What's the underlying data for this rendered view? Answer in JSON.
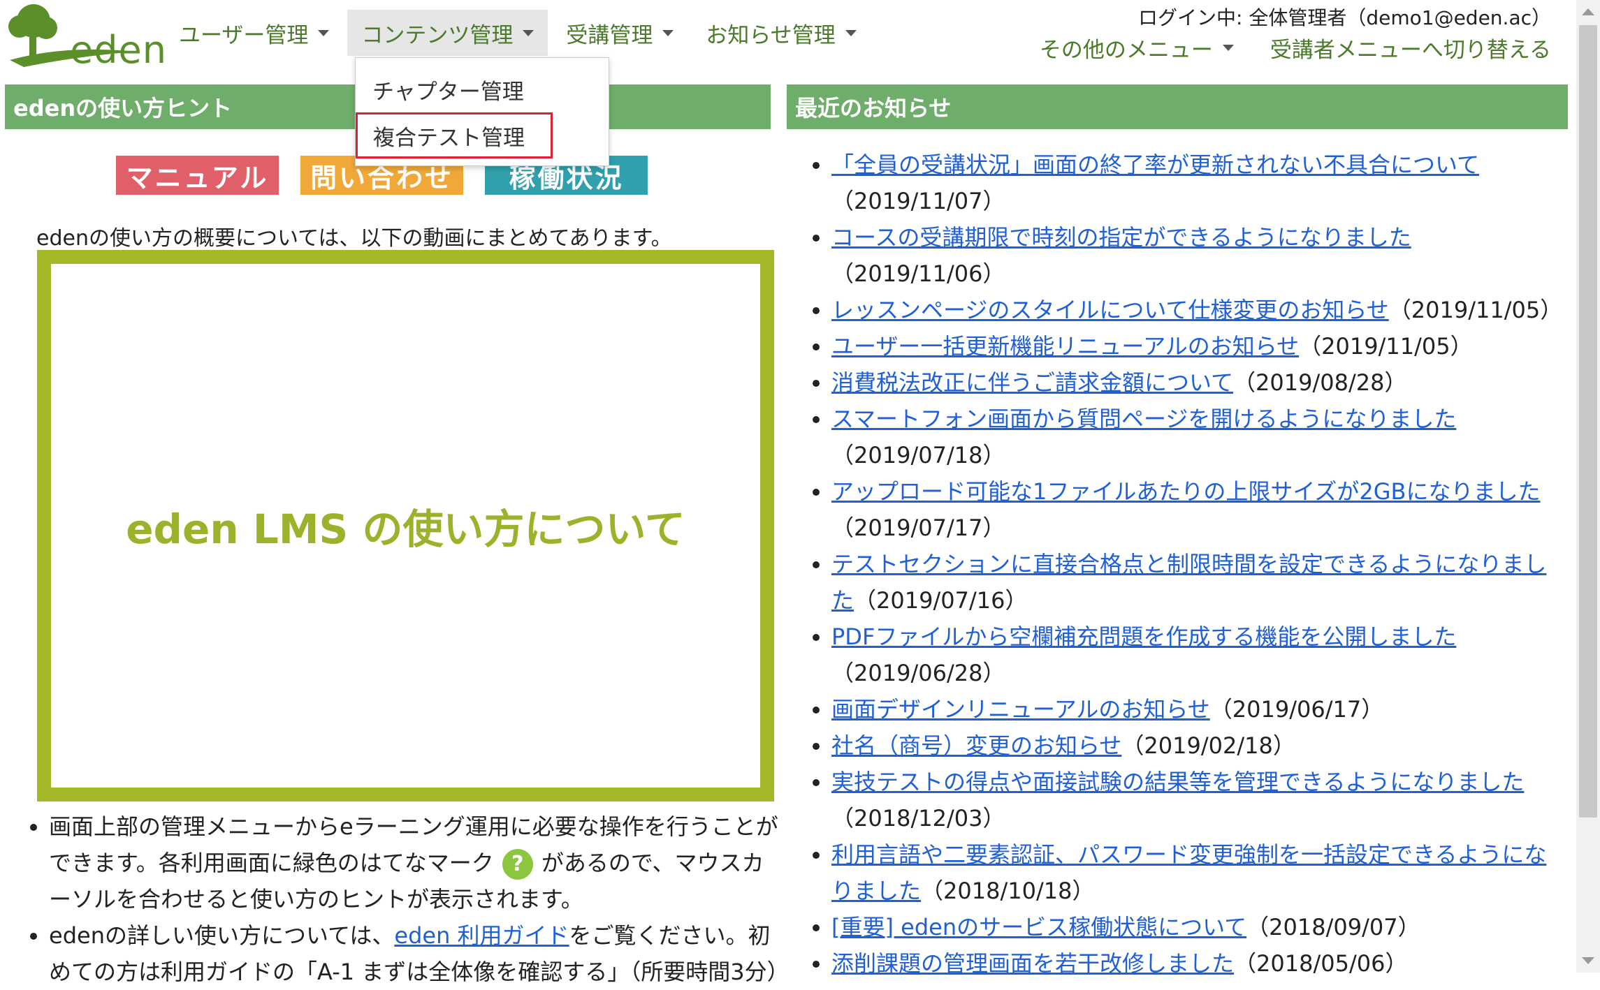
{
  "header": {
    "logo_text": "eden",
    "nav": [
      {
        "label": "ユーザー管理"
      },
      {
        "label": "コンテンツ管理"
      },
      {
        "label": "受講管理"
      },
      {
        "label": "お知らせ管理"
      }
    ],
    "user_info": "ログイン中: 全体管理者（demo1@eden.ac）",
    "other_menu": "その他のメニュー",
    "switch_menu": "受講者メニューへ切り替える"
  },
  "dropdown": {
    "items": [
      {
        "label": "チャプター管理"
      },
      {
        "label": "複合テスト管理"
      }
    ]
  },
  "left": {
    "heading": "edenの使い方ヒント",
    "buttons": {
      "manual": "マニュアル",
      "contact": "問い合わせ",
      "status": "稼働状況"
    },
    "intro": "edenの使い方の概要については、以下の動画にまとめてあります。",
    "video_title": "eden LMS の使い方について",
    "hint1_a": "画面上部の管理メニューからeラーニング運用に必要な操作を行うことができます。各利用画面に緑色のはてなマーク",
    "hint1_icon": "?",
    "hint1_b": "があるので、マウスカーソルを合わせると使い方のヒントが表示されます。",
    "hint2_a": "edenの詳しい使い方については、",
    "hint2_link": "eden 利用ガイド",
    "hint2_b": "をご覧ください。初めての方は利用ガイドの「A-1 まずは全体像を確認する」（所要時間3分）"
  },
  "right": {
    "heading": "最近のお知らせ",
    "news": [
      {
        "title": "「全員の受講状況」画面の終了率が更新されない不具合について",
        "date": "（2019/11/07）"
      },
      {
        "title": "コースの受講期限で時刻の指定ができるようになりました",
        "date": "（2019/11/06）"
      },
      {
        "title": "レッスンページのスタイルについて仕様変更のお知らせ",
        "date": "（2019/11/05）"
      },
      {
        "title": "ユーザー一括更新機能リニューアルのお知らせ",
        "date": "（2019/11/05）"
      },
      {
        "title": "消費税法改正に伴うご請求金額について",
        "date": "（2019/08/28）"
      },
      {
        "title": "スマートフォン画面から質問ページを開けるようになりました",
        "date": "（2019/07/18）"
      },
      {
        "title": "アップロード可能な1ファイルあたりの上限サイズが2GBになりました",
        "date": "（2019/07/17）"
      },
      {
        "title": "テストセクションに直接合格点と制限時間を設定できるようになりました",
        "date": "（2019/07/16）"
      },
      {
        "title": "PDFファイルから空欄補充問題を作成する機能を公開しました",
        "date": "（2019/06/28）"
      },
      {
        "title": "画面デザインリニューアルのお知らせ",
        "date": "（2019/06/17）"
      },
      {
        "title": "社名（商号）変更のお知らせ",
        "date": "（2019/02/18）"
      },
      {
        "title": "実技テストの得点や面接試験の結果等を管理できるようになりました",
        "date": "（2018/12/03）"
      },
      {
        "title": "利用言語や二要素認証、パスワード変更強制を一括設定できるようになりました",
        "date": "（2018/10/18）"
      },
      {
        "title": "[重要] edenのサービス稼働状態について",
        "date": "（2018/09/07）"
      },
      {
        "title": "添削課題の管理画面を若干改修しました",
        "date": "（2018/05/06）"
      }
    ]
  }
}
